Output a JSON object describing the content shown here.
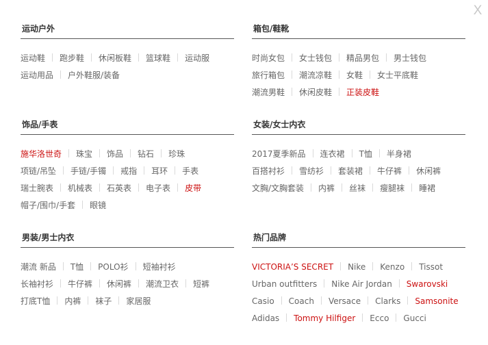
{
  "close_label": "X",
  "colors": {
    "accent_red": "#cc1111",
    "text": "#666666",
    "title": "#333333"
  },
  "sections": [
    {
      "title": "运动户外",
      "rows": [
        [
          {
            "label": "运动鞋"
          },
          {
            "label": "跑步鞋"
          },
          {
            "label": "休闲板鞋"
          },
          {
            "label": "篮球鞋"
          },
          {
            "label": "运动服"
          }
        ],
        [
          {
            "label": "运动用品"
          },
          {
            "label": "户外鞋服/装备"
          }
        ]
      ]
    },
    {
      "title": "箱包/鞋靴",
      "rows": [
        [
          {
            "label": "时尚女包"
          },
          {
            "label": "女士钱包"
          },
          {
            "label": "精品男包"
          },
          {
            "label": "男士钱包"
          }
        ],
        [
          {
            "label": "旅行箱包"
          },
          {
            "label": "潮流凉鞋"
          },
          {
            "label": "女鞋"
          },
          {
            "label": "女士平底鞋"
          }
        ],
        [
          {
            "label": "潮流男鞋"
          },
          {
            "label": "休闲皮鞋"
          },
          {
            "label": "正装皮鞋",
            "highlight": true
          }
        ]
      ]
    },
    {
      "title": "饰品/手表",
      "rows": [
        [
          {
            "label": "施华洛世奇",
            "highlight": true
          },
          {
            "label": "珠宝"
          },
          {
            "label": "饰品"
          },
          {
            "label": "钻石"
          },
          {
            "label": "珍珠"
          }
        ],
        [
          {
            "label": "项链/吊坠"
          },
          {
            "label": "手链/手镯"
          },
          {
            "label": "戒指"
          },
          {
            "label": "耳环"
          },
          {
            "label": "手表"
          }
        ],
        [
          {
            "label": "瑞士腕表"
          },
          {
            "label": "机械表"
          },
          {
            "label": "石英表"
          },
          {
            "label": "电子表"
          },
          {
            "label": "皮带",
            "highlight": true
          }
        ],
        [
          {
            "label": "帽子/围巾/手套"
          },
          {
            "label": "眼镜"
          }
        ]
      ]
    },
    {
      "title": "女装/女士内衣",
      "rows": [
        [
          {
            "label": "2017夏季新品"
          },
          {
            "label": "连衣裙"
          },
          {
            "label": "T恤"
          },
          {
            "label": "半身裙"
          }
        ],
        [
          {
            "label": "百搭衬衫"
          },
          {
            "label": "雪纺衫"
          },
          {
            "label": "套装裙"
          },
          {
            "label": "牛仔裤"
          },
          {
            "label": "休闲裤"
          }
        ],
        [
          {
            "label": "文胸/文胸套装"
          },
          {
            "label": "内裤"
          },
          {
            "label": "丝袜"
          },
          {
            "label": "瘦腿袜"
          },
          {
            "label": "睡裙"
          }
        ]
      ]
    },
    {
      "title": "男装/男士内衣",
      "rows": [
        [
          {
            "label": "潮流 新品"
          },
          {
            "label": "T恤"
          },
          {
            "label": "POLO衫"
          },
          {
            "label": "短袖衬衫"
          }
        ],
        [
          {
            "label": "长袖衬衫"
          },
          {
            "label": "牛仔裤"
          },
          {
            "label": "休闲裤"
          },
          {
            "label": "潮流卫衣"
          },
          {
            "label": "短裤"
          }
        ],
        [
          {
            "label": "打底T恤"
          },
          {
            "label": "内裤"
          },
          {
            "label": "袜子"
          },
          {
            "label": "家居服"
          }
        ]
      ]
    },
    {
      "title": "热门品牌",
      "rows": [
        [
          {
            "label": "VICTORIA’S SECRET",
            "highlight": true
          },
          {
            "label": "Nike"
          },
          {
            "label": "Kenzo"
          },
          {
            "label": "Tissot"
          }
        ],
        [
          {
            "label": "Urban outfitters"
          },
          {
            "label": "Nike Air Jordan"
          },
          {
            "label": "Swarovski",
            "highlight": true
          }
        ],
        [
          {
            "label": "Casio"
          },
          {
            "label": "Coach"
          },
          {
            "label": "Versace"
          },
          {
            "label": "Clarks"
          },
          {
            "label": "Samsonite",
            "highlight": true
          }
        ],
        [
          {
            "label": "Adidas"
          },
          {
            "label": "Tommy Hilfiger",
            "highlight": true
          },
          {
            "label": "Ecco"
          },
          {
            "label": "Gucci"
          }
        ]
      ]
    }
  ]
}
